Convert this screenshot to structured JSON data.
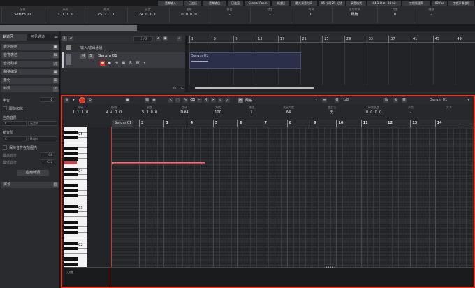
{
  "topbar": {
    "items": [
      "音频输入",
      "已连接",
      "音频输出",
      "已连接",
      "Control Room",
      "未连接",
      "最大录音时间",
      "85 小时 25 分钟",
      "录音格式",
      "44.1 kHz - 24 bit",
      "工程帧速率",
      "60 fps",
      "工程声像准则"
    ]
  },
  "infobar": {
    "cells": [
      {
        "label": "名称",
        "value": "Serum 01"
      },
      {
        "label": "开始",
        "value": "1. 1. 1. 0"
      },
      {
        "label": "结束",
        "value": "25. 1. 1. 0"
      },
      {
        "label": "长度",
        "value": "24. 0. 0. 0"
      },
      {
        "label": "偏移",
        "value": "0. 0. 0. 0"
      },
      {
        "label": "静音",
        "value": "-"
      },
      {
        "label": "锁定",
        "value": "-"
      },
      {
        "label": "转调",
        "value": "0"
      },
      {
        "label": "全局转调",
        "value": "跟随"
      },
      {
        "label": "力度",
        "value": "0"
      },
      {
        "label": "播放",
        "value": "-"
      }
    ]
  },
  "inspector": {
    "tabs": [
      "轨道区",
      "可见通道"
    ],
    "rows": [
      "表达映射",
      "音符表达",
      "音符助手",
      "和弦编辑",
      "量化",
      "转调"
    ],
    "semitone_label": "半音",
    "semitone_value": "0",
    "follow_label": "跟随和弦",
    "current_root_label": "当前音阶",
    "root_value": "C",
    "root_mode": "无音阶",
    "target_label": "新音阶",
    "target_root": "C",
    "target_mode": "Major",
    "keep_range_label": "保持音符在范围内",
    "upper_label": "最高音符",
    "upper_value": "G8",
    "lower_label": "最低音符",
    "lower_value": "C-2",
    "apply_label": "应用转调",
    "bottom_label": "资源"
  },
  "project": {
    "track_counter": "3 / 3",
    "folder_label": "输入/输出通道",
    "track_name": "Serum 01",
    "track_buttons": [
      "M",
      "S",
      "R",
      "W"
    ],
    "ruler_ticks": [
      "1",
      "5",
      "9",
      "13",
      "17",
      "21",
      "25",
      "29",
      "33",
      "37",
      "41",
      "45",
      "49"
    ],
    "clip_name": "Serum 01"
  },
  "editor": {
    "toolbar_grid_label": "网格",
    "quantize_value": "1/8",
    "instrument": "Serum 01",
    "info_cells": [
      {
        "label": "开始",
        "value": "1. 1. 1. 0"
      },
      {
        "label": "结束",
        "value": "4. 4. 1. 0"
      },
      {
        "label": "长度",
        "value": "3. 3. 0. 0"
      },
      {
        "label": "音高",
        "value": "D#4"
      },
      {
        "label": "力度",
        "value": "100"
      },
      {
        "label": "通道",
        "value": "1"
      },
      {
        "label": "关闭力度",
        "value": "64"
      },
      {
        "label": "变音法",
        "value": "无"
      },
      {
        "label": "释放长度",
        "value": "0. 0. 0. 0"
      },
      {
        "label": "声音",
        "value": "-"
      },
      {
        "label": "文本",
        "value": ""
      }
    ],
    "part_label": "Serum 01",
    "ruler_ticks": [
      "2",
      "3",
      "4",
      "5",
      "6",
      "7",
      "8",
      "9",
      "10",
      "11",
      "12",
      "13",
      "14"
    ],
    "octave_labels": [
      "C5",
      "C4",
      "C3",
      "C2"
    ],
    "velocity_label": "力度"
  },
  "colors": {
    "accent_red": "#e53a1f",
    "note_color": "#b9474e",
    "clip_bg": "#2c2f4a"
  }
}
